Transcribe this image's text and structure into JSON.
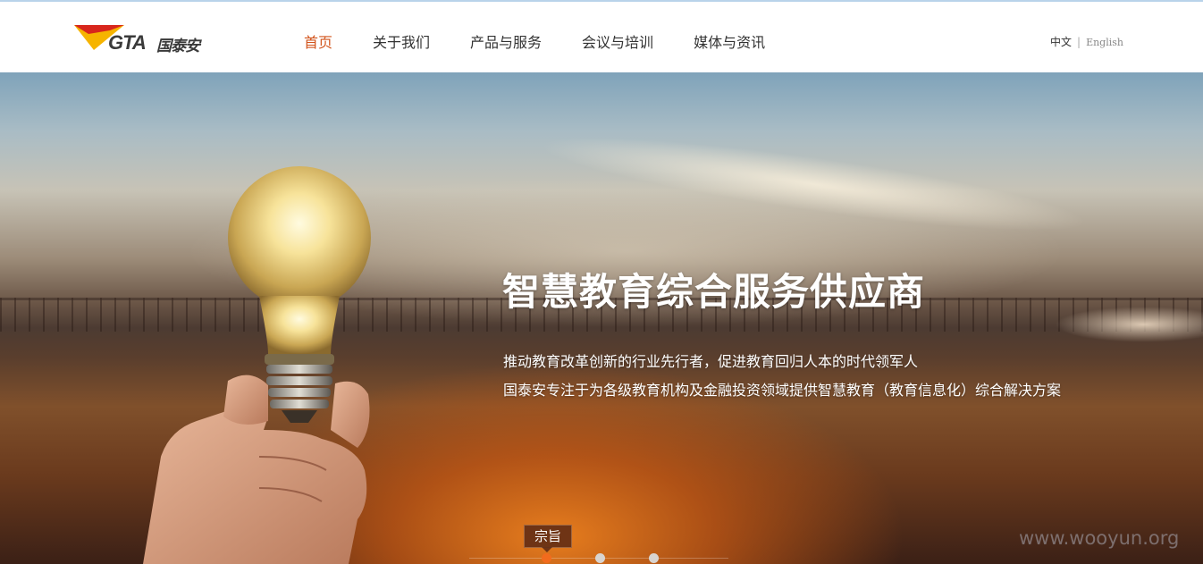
{
  "header": {
    "logo": {
      "brand_en": "GTA",
      "brand_cn": "国泰安"
    },
    "nav": [
      {
        "label": "首页",
        "active": true
      },
      {
        "label": "关于我们",
        "active": false
      },
      {
        "label": "产品与服务",
        "active": false
      },
      {
        "label": "会议与培训",
        "active": false
      },
      {
        "label": "媒体与资讯",
        "active": false
      }
    ],
    "lang": {
      "cn": "中文",
      "separator": "|",
      "en": "English"
    }
  },
  "banner": {
    "headline": "智慧教育综合服务供应商",
    "lines": [
      "推动教育改革创新的行业先行者，促进教育回归人本的时代领军人",
      "国泰安专注于为各级教育机构及金融投资领域提供智慧教育（教育信息化）综合解决方案"
    ],
    "slide_tag": "宗旨",
    "slides": {
      "count": 3,
      "active_index": 0
    },
    "watermark": "www.wooyun.org"
  },
  "colors": {
    "accent": "#d2541c",
    "active_dot": "#f26b1d"
  },
  "icons": [
    "gta-logo-icon",
    "light-bulb-icon",
    "hand-icon"
  ]
}
